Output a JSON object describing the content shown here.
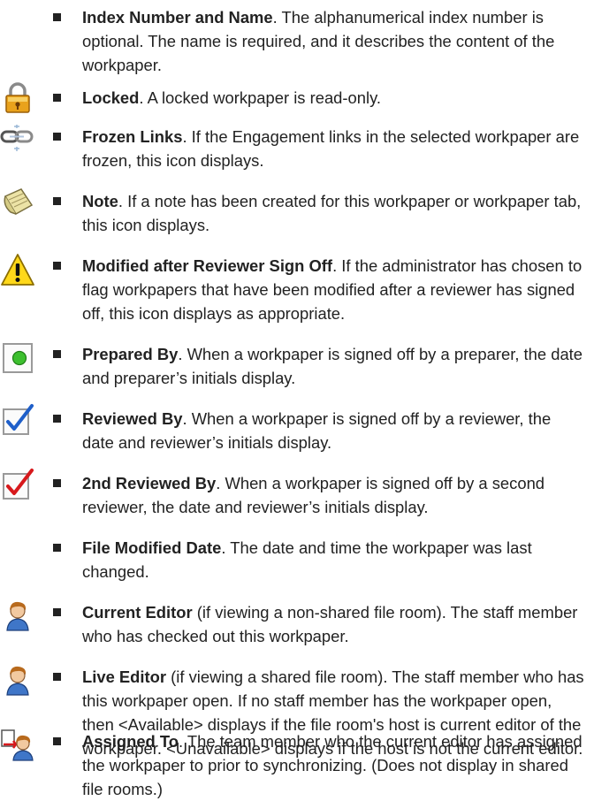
{
  "items": [
    {
      "icon": "none",
      "term": "Index Number and Name",
      "desc": ". The alphanumerical index number is optional. The name is required, and it describes the content of the workpaper."
    },
    {
      "icon": "padlock-icon",
      "term": "Locked",
      "desc": ". A locked workpaper is read-only."
    },
    {
      "icon": "frozen-link-icon",
      "term": "Frozen Links",
      "desc": ". If the Engagement links in the selected workpaper are frozen, this icon displays."
    },
    {
      "icon": "note-icon",
      "term": "Note",
      "desc": ". If a note has been created for this workpaper or workpaper tab, this icon displays."
    },
    {
      "icon": "warning-icon",
      "term": "Modified after Reviewer Sign Off",
      "desc": ". If the administrator has chosen to flag workpapers that have been modified after a reviewer has signed off, this icon displays as appropriate."
    },
    {
      "icon": "prepared-signoff-icon",
      "term": "Prepared By",
      "desc": ". When a workpaper is signed off by a preparer, the date and preparer’s initials display."
    },
    {
      "icon": "reviewed-check-icon",
      "term": "Reviewed By",
      "desc": ". When a workpaper is signed off by a reviewer, the date and reviewer’s initials display."
    },
    {
      "icon": "second-review-check-icon",
      "term": "2nd Reviewed By",
      "desc": ". When a workpaper is signed off by a second reviewer, the date and reviewer’s initials display."
    },
    {
      "icon": "none",
      "term": "File Modified Date",
      "desc": ". The date and time the workpaper was last changed."
    },
    {
      "icon": "person-icon",
      "term": "Current Editor",
      "desc": " (if viewing a non-shared file room). The staff member who has checked out this workpaper."
    },
    {
      "icon": "person-icon",
      "term": "Live Editor",
      "desc": " (if viewing a shared file room). The staff member who has this workpaper open. If no staff member has the workpaper open, then <Available> displays if the file room's host is current editor of the workpaper. <Unavailable> displays if the host is not the current editor."
    },
    {
      "icon": "assigned-person-icon",
      "term": "Assigned To",
      "desc": ". The team member who the current editor has assigned the workpaper to prior to synchronizing. (Does not display in shared file rooms.)"
    }
  ]
}
